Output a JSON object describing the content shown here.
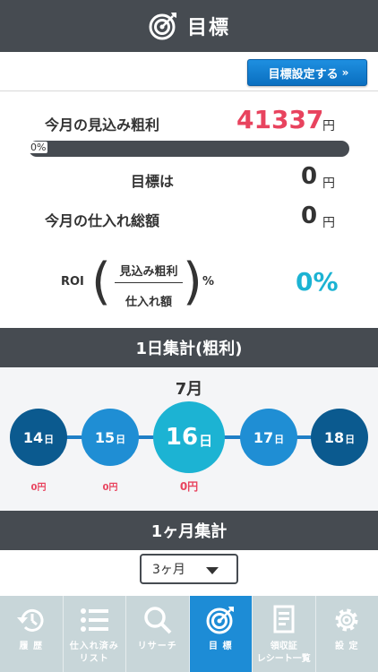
{
  "header": {
    "title": "目標",
    "icon": "target-icon"
  },
  "goal_button": {
    "label": "目標設定する",
    "chevron": "»"
  },
  "summary": {
    "expected_profit_label": "今月の見込み粗利",
    "expected_profit_value": "41337",
    "expected_profit_unit": "円",
    "progress_label": "0%",
    "progress_fraction": 0,
    "target_label": "目標は",
    "target_value": "0",
    "target_unit": "円",
    "purchase_total_label": "今月の仕入れ総額",
    "purchase_total_value": "0",
    "purchase_total_unit": "円"
  },
  "roi": {
    "label": "ROI",
    "numerator": "見込み粗利",
    "denominator": "仕入れ額",
    "percent_sign": "%",
    "value": "0%"
  },
  "daily": {
    "section_title": "1日集計(粗利)",
    "month": "7月",
    "day_unit": "日",
    "days": [
      {
        "day": "14",
        "value": "0円",
        "color": "#0b5a8f"
      },
      {
        "day": "15",
        "value": "0円",
        "color": "#1f8ed4"
      },
      {
        "day": "16",
        "value": "0円",
        "color": "#1cb3d3",
        "selected": true
      },
      {
        "day": "17",
        "value": "",
        "color": "#1f8ed4"
      },
      {
        "day": "18",
        "value": "",
        "color": "#0b5a8f"
      }
    ]
  },
  "monthly": {
    "section_title": "1ヶ月集計",
    "period_selected": "3ヶ月"
  },
  "tabs": [
    {
      "label": "履 歴",
      "icon": "history-icon"
    },
    {
      "label": "仕入れ済み\nリスト",
      "icon": "list-icon"
    },
    {
      "label": "リサーチ",
      "icon": "search-icon"
    },
    {
      "label": "目 標",
      "icon": "target-icon",
      "active": true
    },
    {
      "label": "領収証\nレシート一覧",
      "icon": "receipt-icon"
    },
    {
      "label": "設 定",
      "icon": "gear-icon"
    }
  ],
  "colors": {
    "header_bg": "#464b51",
    "accent_blue": "#1d8cd6",
    "accent_cyan": "#1cb3d3",
    "profit_red": "#e8435e"
  }
}
